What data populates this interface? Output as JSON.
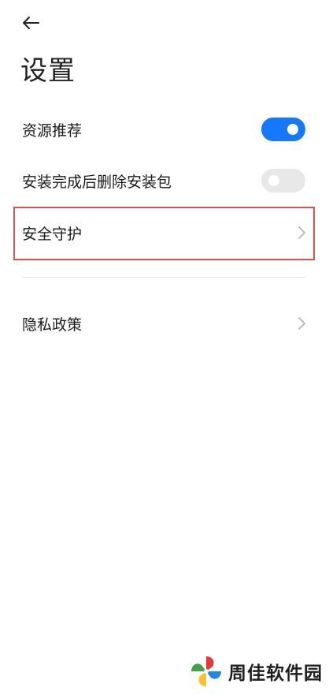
{
  "header": {
    "back_icon": "arrow-left-icon",
    "title": "设置"
  },
  "settings": {
    "resource_recommend": {
      "label": "资源推荐",
      "toggle_state": "on",
      "toggle_color": "#1677ff"
    },
    "delete_package": {
      "label": "安装完成后删除安装包",
      "toggle_state": "off",
      "toggle_color": "#e8e8e8"
    },
    "security_protection": {
      "label": "安全守护",
      "chevron_icon": "chevron-right-icon",
      "highlight_color": "#d9534f"
    },
    "privacy_policy": {
      "label": "隐私政策",
      "chevron_icon": "chevron-right-icon"
    }
  },
  "watermark": {
    "text": "周佳软件园",
    "logo_icon": "pinwheel-logo-icon"
  }
}
